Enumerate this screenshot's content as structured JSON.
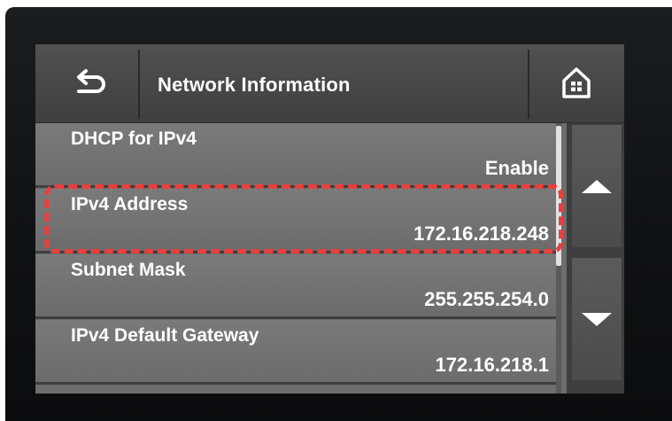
{
  "header": {
    "title": "Network Information",
    "back_icon": "back-arrow-icon",
    "home_icon": "home-icon"
  },
  "list": {
    "items": [
      {
        "label": "DHCP for IPv4",
        "value": "Enable"
      },
      {
        "label": "IPv4 Address",
        "value": "172.16.218.248"
      },
      {
        "label": "Subnet Mask",
        "value": "255.255.254.0"
      },
      {
        "label": "IPv4 Default Gateway",
        "value": "172.16.218.1"
      }
    ]
  },
  "scroll": {
    "up_icon": "arrow-up-icon",
    "down_icon": "arrow-down-icon"
  },
  "highlight": {
    "target": "IPv4 Address",
    "color": "#e8403f"
  }
}
